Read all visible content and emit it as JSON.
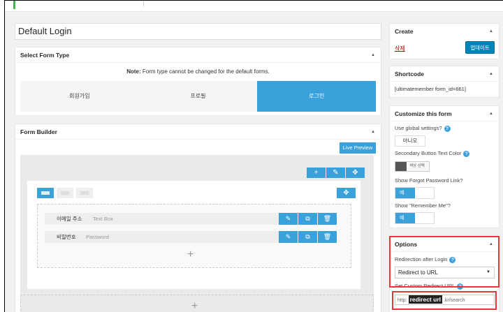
{
  "form_title": "Default Login",
  "select_form_type": {
    "heading": "Select Form Type",
    "note_label": "Note:",
    "note_text": "Form type cannot be changed for the default forms.",
    "types": [
      "회원가입",
      "프로필",
      "로그인"
    ],
    "active_type": "로그인"
  },
  "form_builder": {
    "heading": "Form Builder",
    "live_preview": "Live Preview",
    "fields": [
      {
        "label": "이메일 주소",
        "type": "Text Box"
      },
      {
        "label": "비밀번호",
        "type": "Password"
      }
    ],
    "add_symbol": "+"
  },
  "create": {
    "heading": "Create",
    "delete_label": "삭제",
    "update_button": "업데이트"
  },
  "shortcode": {
    "heading": "Shortcode",
    "code": "[ultimatemember form_id=661]"
  },
  "customize": {
    "heading": "Customize this form",
    "use_global_label": "Use global settings?",
    "use_global_value": "아니오",
    "secondary_color_label": "Secondary Button Text Color",
    "color_picker_label": "색상 선택",
    "forgot_password_label": "Show Forgot Password Link?",
    "forgot_password_value": "예",
    "remember_me_label": "Show \"Remember Me\"?",
    "remember_me_value": "예"
  },
  "options": {
    "heading": "Options",
    "redirection_label": "Redirection after Login",
    "redirection_value": "Redirect to URL",
    "custom_url_label": "Set Custom Redirect URL",
    "url_prefix": "http:",
    "url_mask": "redirect url",
    "url_suffix": ".kr/search"
  },
  "icons": {
    "help": "?",
    "collapse": "▲",
    "dropdown": "▼",
    "plus": "+",
    "edit": "✎",
    "copy": "⧉",
    "trash": "🗑",
    "move": "✥"
  },
  "colors": {
    "accent": "#3ba1da",
    "primary_button": "#0085ba",
    "delete": "#aa0000",
    "highlight": "#e53a3a"
  }
}
